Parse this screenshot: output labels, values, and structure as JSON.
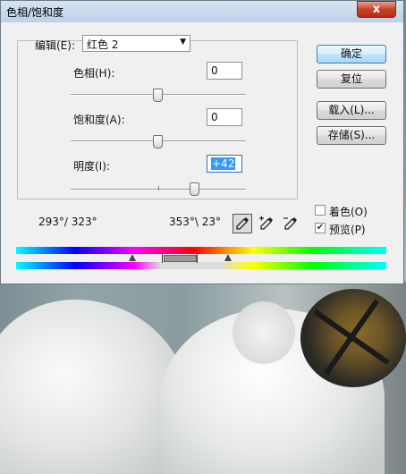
{
  "dialog": {
    "title": "色相/饱和度",
    "close_label": "x"
  },
  "edit": {
    "label": "编辑(E):",
    "selected": "红色 2"
  },
  "hue": {
    "label": "色相(H):",
    "value": "0",
    "level": 0
  },
  "saturation": {
    "label": "饱和度(A):",
    "value": "0",
    "level": 0
  },
  "lightness": {
    "label": "明度(I):",
    "value": "+42",
    "level": 42
  },
  "buttons": {
    "ok": "确定",
    "reset": "复位",
    "load": "载入(L)...",
    "save": "存储(S)..."
  },
  "options": {
    "colorize": {
      "label": "着色(O)",
      "checked": false
    },
    "preview": {
      "label": "预览(P)",
      "checked": true
    }
  },
  "range": {
    "left_text": "293°/ 323°",
    "right_text": "353°\\ 23°"
  },
  "icons": {
    "eyedropper": "eyedropper-icon",
    "eyedropper_plus": "eyedropper-plus-icon",
    "eyedropper_minus": "eyedropper-minus-icon"
  }
}
